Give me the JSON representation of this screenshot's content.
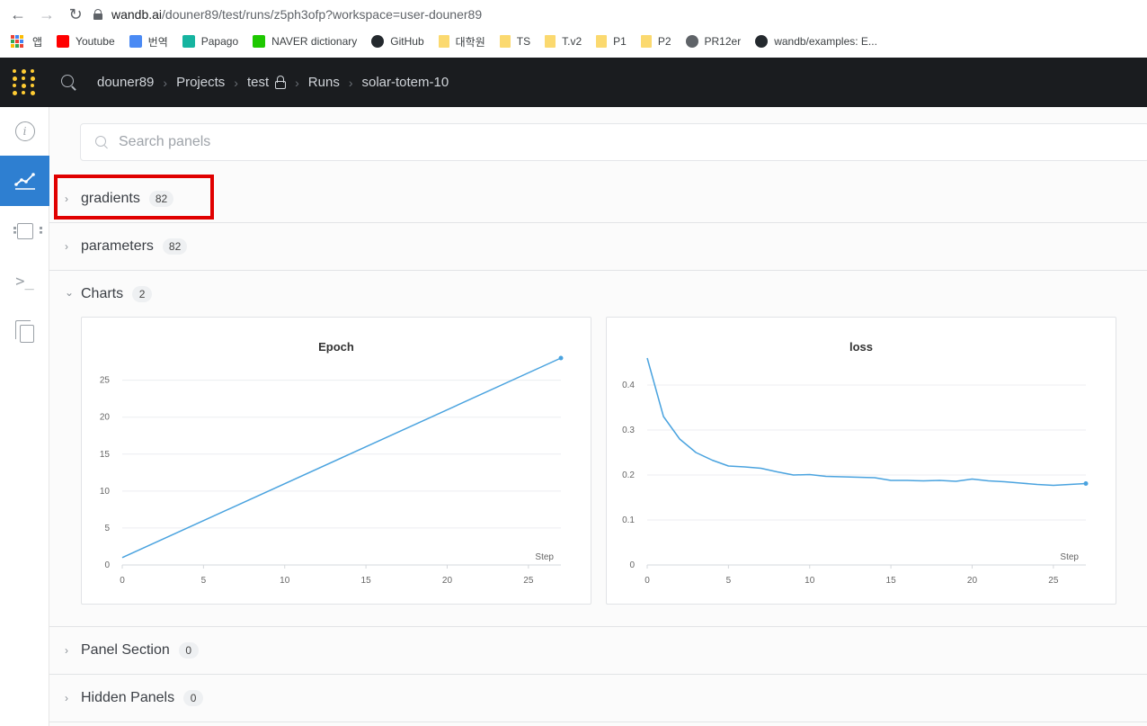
{
  "browser": {
    "url_host": "wandb.ai",
    "url_path": "/douner89/test/runs/z5ph3ofp?workspace=user-douner89",
    "bookmarks": [
      {
        "label": "앱",
        "icon": "apps-grid-icon"
      },
      {
        "label": "Youtube",
        "icon": "youtube-icon",
        "color": "#ff0000"
      },
      {
        "label": "번역",
        "icon": "translate-icon",
        "color": "#4a8af4"
      },
      {
        "label": "Papago",
        "icon": "papago-icon",
        "color": "#16b4a0"
      },
      {
        "label": "NAVER dictionary",
        "icon": "naver-icon",
        "color": "#1ec800"
      },
      {
        "label": "GitHub",
        "icon": "github-icon",
        "color": "#24292e"
      },
      {
        "label": "대학원",
        "icon": "folder-icon"
      },
      {
        "label": "TS",
        "icon": "folder-icon"
      },
      {
        "label": "T.v2",
        "icon": "folder-icon"
      },
      {
        "label": "P1",
        "icon": "folder-icon"
      },
      {
        "label": "P2",
        "icon": "folder-icon"
      },
      {
        "label": "PR12er",
        "icon": "globe-icon",
        "color": "#5f6368"
      },
      {
        "label": "wandb/examples: E...",
        "icon": "github-icon",
        "color": "#24292e"
      }
    ]
  },
  "topbar": {
    "breadcrumbs": [
      "douner89",
      "Projects",
      "test",
      "Runs",
      "solar-totem-10"
    ]
  },
  "search": {
    "placeholder": "Search panels",
    "value": ""
  },
  "sections": [
    {
      "title": "gradients",
      "count": "82",
      "expanded": false
    },
    {
      "title": "parameters",
      "count": "82",
      "expanded": false
    },
    {
      "title": "Charts",
      "count": "2",
      "expanded": true
    },
    {
      "title": "Panel Section",
      "count": "0",
      "expanded": false
    },
    {
      "title": "Hidden Panels",
      "count": "0",
      "expanded": false
    }
  ],
  "colors": {
    "accent": "#2e7fd1",
    "line": "#4aa3df",
    "highlight": "#e00000",
    "topbar": "#1a1c1f",
    "logo": "#ffcc33"
  },
  "chart_data": [
    {
      "type": "line",
      "title": "Epoch",
      "xlabel": "Step",
      "ylabel": "",
      "x": [
        0,
        27
      ],
      "y": [
        1,
        28
      ],
      "xlim": [
        0,
        27
      ],
      "ylim": [
        0,
        28
      ],
      "xticks": [
        0,
        5,
        10,
        15,
        20,
        25
      ],
      "yticks": [
        0,
        5,
        10,
        15,
        20,
        25
      ]
    },
    {
      "type": "line",
      "title": "loss",
      "xlabel": "Step",
      "ylabel": "",
      "x": [
        0,
        1,
        2,
        3,
        4,
        5,
        6,
        7,
        8,
        9,
        10,
        11,
        12,
        13,
        14,
        15,
        16,
        17,
        18,
        19,
        20,
        21,
        22,
        23,
        24,
        25,
        26,
        27
      ],
      "y": [
        0.46,
        0.33,
        0.28,
        0.25,
        0.233,
        0.22,
        0.218,
        0.215,
        0.207,
        0.2,
        0.201,
        0.197,
        0.196,
        0.195,
        0.194,
        0.188,
        0.188,
        0.187,
        0.188,
        0.186,
        0.191,
        0.187,
        0.185,
        0.182,
        0.179,
        0.177,
        0.179,
        0.181
      ],
      "xlim": [
        0,
        27
      ],
      "ylim": [
        0,
        0.46
      ],
      "xticks": [
        0,
        5,
        10,
        15,
        20,
        25
      ],
      "yticks": [
        0,
        0.1,
        0.2,
        0.3,
        0.4
      ]
    }
  ]
}
